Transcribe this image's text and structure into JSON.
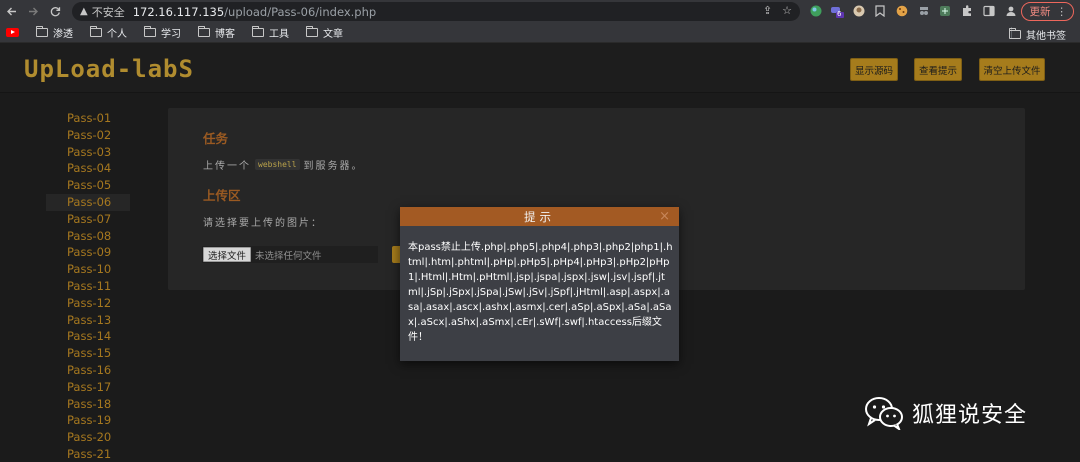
{
  "browser": {
    "insecure_label": "不安全",
    "url_host": "172.16.117.135",
    "url_path": "/upload/Pass-06/index.php",
    "update_label": "更新",
    "extension_badge": "6"
  },
  "bookmarks": {
    "items": [
      "渗透",
      "个人",
      "学习",
      "博客",
      "工具",
      "文章"
    ],
    "other": "其他书签"
  },
  "site": {
    "logo": "UpLoad-labS",
    "buttons": [
      "显示源码",
      "查看提示",
      "清空上传文件"
    ]
  },
  "sidebar": {
    "items": [
      "Pass-01",
      "Pass-02",
      "Pass-03",
      "Pass-04",
      "Pass-05",
      "Pass-06",
      "Pass-07",
      "Pass-08",
      "Pass-09",
      "Pass-10",
      "Pass-11",
      "Pass-12",
      "Pass-13",
      "Pass-14",
      "Pass-15",
      "Pass-16",
      "Pass-17",
      "Pass-18",
      "Pass-19",
      "Pass-20",
      "Pass-21"
    ],
    "active": "Pass-06"
  },
  "main": {
    "task_title": "任务",
    "task_before": "上传一个",
    "task_code": "webshell",
    "task_after": "到服务器。",
    "upload_title": "上传区",
    "select_label": "请选择要上传的图片：",
    "file_button": "选择文件",
    "file_placeholder": "未选择任何文件"
  },
  "modal": {
    "title": "提示",
    "close": "×",
    "message": "本pass禁止上传.php|.php5|.php4|.php3|.php2|php1|.html|.htm|.phtml|.pHp|.pHp5|.pHp4|.pHp3|.pHp2|pHp1|.Html|.Htm|.pHtml|.jsp|.jspa|.jspx|.jsw|.jsv|.jspf|.jtml|.jSp|.jSpx|.jSpa|.jSw|.jSv|.jSpf|.jHtml|.asp|.aspx|.asa|.asax|.ascx|.ashx|.asmx|.cer|.aSp|.aSpx|.aSa|.aSax|.aScx|.aShx|.aSmx|.cEr|.sWf|.swf|.htaccess后缀文件！"
  },
  "watermark": {
    "text": "狐狸说安全"
  }
}
